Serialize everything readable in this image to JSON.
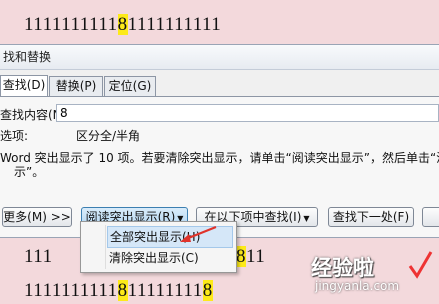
{
  "document": {
    "line1": {
      "before": "1111111111",
      "highlight": "8",
      "after": "1111111111"
    },
    "line2": {
      "before": "111",
      "highlight": "8",
      "after": "11"
    },
    "line3": {
      "before": "1111111111",
      "highlight": "8",
      "after": "11111111",
      "highlight2": "8"
    }
  },
  "dialog": {
    "title": "找和替换",
    "tabs": [
      {
        "label": "查找(D)",
        "active": true
      },
      {
        "label": "替换(P)",
        "active": false
      },
      {
        "label": "定位(G)",
        "active": false
      }
    ],
    "find_label": "查找内容(N):",
    "find_value": "8",
    "options_label": "选项:",
    "options_value": "区分全/半角",
    "message_line1": "Word 突出显示了 10 项。若要清除突出显示，请单击“阅读突出显示”，然后单击“清",
    "message_line2": "示”。",
    "buttons": {
      "more": "更多(M) >>",
      "reading_highlight": "阅读突出显示(R)",
      "find_in": "在以下项中查找(I)",
      "find_next": "查找下一处(F)"
    }
  },
  "menu": {
    "items": [
      "全部突出显示(H)",
      "清除突出显示(C)"
    ]
  },
  "watermark": {
    "title": "经验啦",
    "url": "jingyanla.com"
  },
  "colors": {
    "highlight": "#fdea19",
    "page": "#f3d9dc",
    "arrow": "#e0332b"
  }
}
